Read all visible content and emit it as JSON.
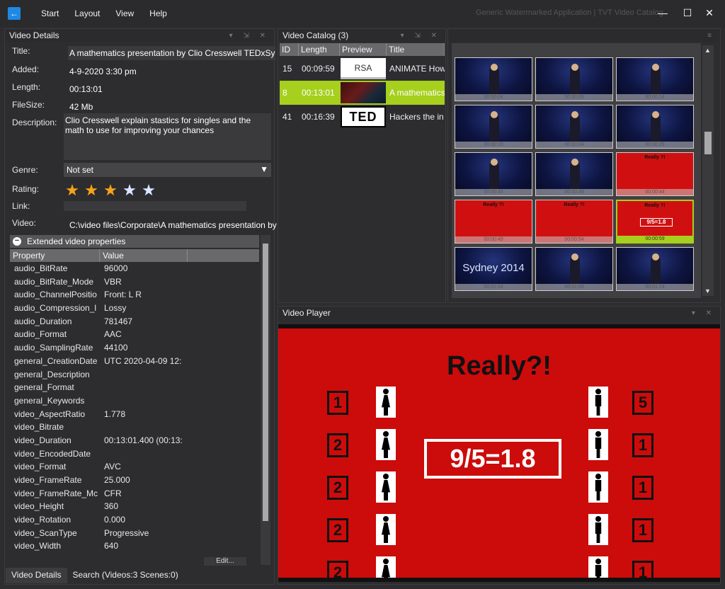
{
  "window": {
    "title": "Generic Watermarked Application | TVT Video Catalog",
    "minimize": "—",
    "maximize": "☐",
    "close": "✕"
  },
  "menu": [
    "Start",
    "Layout",
    "View",
    "Help"
  ],
  "details_panel": {
    "title": "Video Details",
    "labels": {
      "title": "Title:",
      "added": "Added:",
      "length": "Length:",
      "filesize": "FileSize:",
      "description": "Description:",
      "genre": "Genre:",
      "rating": "Rating:",
      "link": "Link:",
      "video": "Video:"
    },
    "values": {
      "title": "A mathematics presentation by Clio Cresswell TEDxSydney",
      "added": "4-9-2020 3:30 pm",
      "length": "00:13:01",
      "filesize": "42 Mb",
      "description": "Clio Cresswell explain stastics for singles and the math to use for improving your chances",
      "genre": "Not set",
      "link": "",
      "video": "C:\\video files\\Corporate\\A mathematics presentation by Clio Cresswell"
    },
    "rating": 3,
    "rating_max": 5,
    "extended": {
      "header": "Extended video properties",
      "columns": [
        "Property",
        "Value"
      ],
      "rows": [
        [
          "audio_BitRate",
          "96000"
        ],
        [
          "audio_BitRate_Mode",
          "VBR"
        ],
        [
          "audio_ChannelPositio",
          "Front: L R"
        ],
        [
          "audio_Compression_l",
          "Lossy"
        ],
        [
          "audio_Duration",
          "781467"
        ],
        [
          "audio_Format",
          "AAC"
        ],
        [
          "audio_SamplingRate",
          "44100"
        ],
        [
          "general_CreationDate",
          "UTC 2020-04-09 12:"
        ],
        [
          "general_Description",
          ""
        ],
        [
          "general_Format",
          ""
        ],
        [
          "general_Keywords",
          ""
        ],
        [
          "video_AspectRatio",
          "1.778"
        ],
        [
          "video_Bitrate",
          ""
        ],
        [
          "video_Duration",
          "00:13:01.400 (00:13:"
        ],
        [
          "video_EncodedDate",
          ""
        ],
        [
          "video_Format",
          "AVC"
        ],
        [
          "video_FrameRate",
          "25.000"
        ],
        [
          "video_FrameRate_Mc",
          "CFR"
        ],
        [
          "video_Height",
          "360"
        ],
        [
          "video_Rotation",
          "0.000"
        ],
        [
          "video_ScanType",
          "Progressive"
        ],
        [
          "video_Width",
          "640"
        ]
      ],
      "edit_label": "Edit..."
    },
    "tabs": [
      "Video Details",
      "Search (Videos:3 Scenes:0)"
    ]
  },
  "catalog": {
    "title": "Video Catalog (3)",
    "columns": [
      "ID",
      "Length",
      "Preview",
      "Title"
    ],
    "rows": [
      {
        "id": "15",
        "length": "00:09:59",
        "preview": "RSA",
        "title": "ANIMATE How"
      },
      {
        "id": "8",
        "length": "00:13:01",
        "preview": "",
        "title": "A mathematics"
      },
      {
        "id": "41",
        "length": "00:16:39",
        "preview": "TED",
        "title": "Hackers the in"
      }
    ],
    "selected_index": 1
  },
  "scenes": {
    "items": [
      {
        "kind": "blue",
        "stamp": "00:00:04"
      },
      {
        "kind": "blue",
        "stamp": "00:00:09"
      },
      {
        "kind": "blue",
        "stamp": "00:00:14"
      },
      {
        "kind": "blue",
        "stamp": "00:00:19"
      },
      {
        "kind": "blue",
        "stamp": "00:00:24"
      },
      {
        "kind": "blue",
        "stamp": "00:00:29"
      },
      {
        "kind": "blue",
        "stamp": "00:00:34"
      },
      {
        "kind": "blue",
        "stamp": "00:00:39"
      },
      {
        "kind": "red",
        "stamp": "00:00:44",
        "title": "Really ?!"
      },
      {
        "kind": "red",
        "stamp": "00:00:49",
        "title": "Really ?!"
      },
      {
        "kind": "red",
        "stamp": "00:00:54",
        "title": "Really ?!"
      },
      {
        "kind": "red",
        "stamp": "00:00:59",
        "title": "Really ?!",
        "eq": "9/5=1.8",
        "selected": true
      },
      {
        "kind": "text",
        "stamp": "00:01:04",
        "text": "Sydney 2014"
      },
      {
        "kind": "blue",
        "stamp": "00:01:09"
      },
      {
        "kind": "blue",
        "stamp": "00:01:14"
      }
    ]
  },
  "player": {
    "title": "Video Player",
    "headline": "Really?!",
    "equation": "9/5=1.8",
    "left_numbers": [
      "1",
      "2",
      "2",
      "2",
      "2"
    ],
    "right_numbers": [
      "5",
      "1",
      "1",
      "1",
      "1"
    ]
  },
  "colors": {
    "accent": "#a6cf1e",
    "app_icon": "#1e88e5",
    "player_bg": "#cc0b0b",
    "star_on": "#f2a41c",
    "star_off": "#dde6ff"
  }
}
